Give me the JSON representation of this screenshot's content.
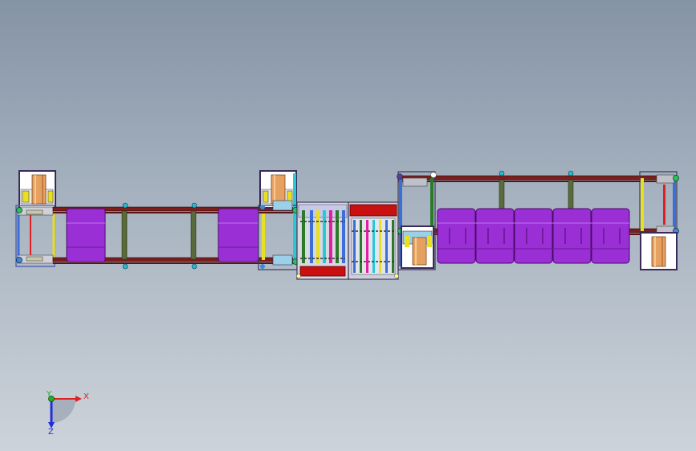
{
  "triad": {
    "x_label": "X",
    "y_label": "Y",
    "z_label": "Z"
  },
  "colors": {
    "background_top": "#8593a6",
    "background_bottom": "#cdd3da",
    "rail": "#7a1e1e",
    "product": "#9a2fd6",
    "product_dark": "#7a1fb0",
    "roller": "#e0a060",
    "cabinet_red": "#c81010",
    "cyan": "#28c8d8",
    "yellow": "#e8e020",
    "blue": "#3b6fd8",
    "green": "#2a7a2a",
    "axis_x": "#e02020",
    "axis_y": "#20b020",
    "axis_z": "#2030d8"
  }
}
